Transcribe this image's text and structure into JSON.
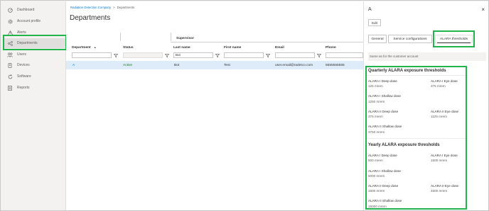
{
  "nav": {
    "items": [
      {
        "label": "Dashboard",
        "icon": "dashboard-gauge-icon"
      },
      {
        "label": "Account profile",
        "icon": "gear-icon"
      },
      {
        "label": "Alerts",
        "icon": "warning-triangle-icon"
      },
      {
        "label": "Departments",
        "icon": "org-tree-icon"
      },
      {
        "label": "Users",
        "icon": "users-icon"
      },
      {
        "label": "Devices",
        "icon": "device-icon"
      },
      {
        "label": "Software",
        "icon": "refresh-icon"
      },
      {
        "label": "Reports",
        "icon": "report-icon"
      }
    ],
    "active_index": 3
  },
  "breadcrumb": {
    "company": "Radiation Detection Company",
    "separator": ">",
    "current": "Departments"
  },
  "page": {
    "title": "Departments"
  },
  "grid": {
    "group_header": "Supervisor",
    "columns": [
      "Department",
      "Status",
      "Last name",
      "First name",
      "Email",
      "Phone"
    ],
    "sort_indicator": "▲",
    "filters": {
      "last_name": "Bot"
    },
    "rows": [
      {
        "department": "A",
        "status": "Active",
        "last_name": "Bot",
        "first_name": "Test",
        "email": "user.email@radetco.com",
        "phone": "5555555555"
      }
    ]
  },
  "panel": {
    "title": "A",
    "close": "×",
    "edit_label": "Edit",
    "tabs": [
      "General",
      "Service configurations",
      "ALARA thresholds"
    ],
    "active_tab": 2,
    "same_as": "Same as for the customer account",
    "quarterly": {
      "title": "Quarterly ALARA exposure thresholds",
      "i_deep": {
        "label": "ALARA I Deep dose",
        "value": "125 mrem"
      },
      "i_eye": {
        "label": "ALARA I Eye dose",
        "value": "375 mrem"
      },
      "i_shallow": {
        "label": "ALARA I Shallow dose",
        "value": "1250 mrem"
      },
      "ii_deep": {
        "label": "ALARA II Deep dose",
        "value": "375 mrem"
      },
      "ii_eye": {
        "label": "ALARA II Eye dose",
        "value": "1125 mrem"
      },
      "ii_shallow": {
        "label": "ALARA II Shallow dose",
        "value": "3750 mrem"
      }
    },
    "yearly": {
      "title": "Yearly ALARA exposure thresholds",
      "i_deep": {
        "label": "ALARA I Deep dose",
        "value": "500 mrem"
      },
      "i_eye": {
        "label": "ALARA I Eye dose",
        "value": "1500 mrem"
      },
      "i_shallow": {
        "label": "ALARA I Shallow dose",
        "value": "5000 mrem"
      },
      "ii_deep": {
        "label": "ALARA II Deep dose",
        "value": "1500 mrem"
      },
      "ii_eye": {
        "label": "ALARA II Eye dose",
        "value": "4500 mrem"
      },
      "ii_shallow": {
        "label": "ALARA II Shallow dose",
        "value": "15000 mrem"
      }
    }
  },
  "colors": {
    "accent": "#0078d4",
    "highlight": "#22b34c",
    "active_status": "#107c10",
    "selected_row": "#deecf9"
  }
}
